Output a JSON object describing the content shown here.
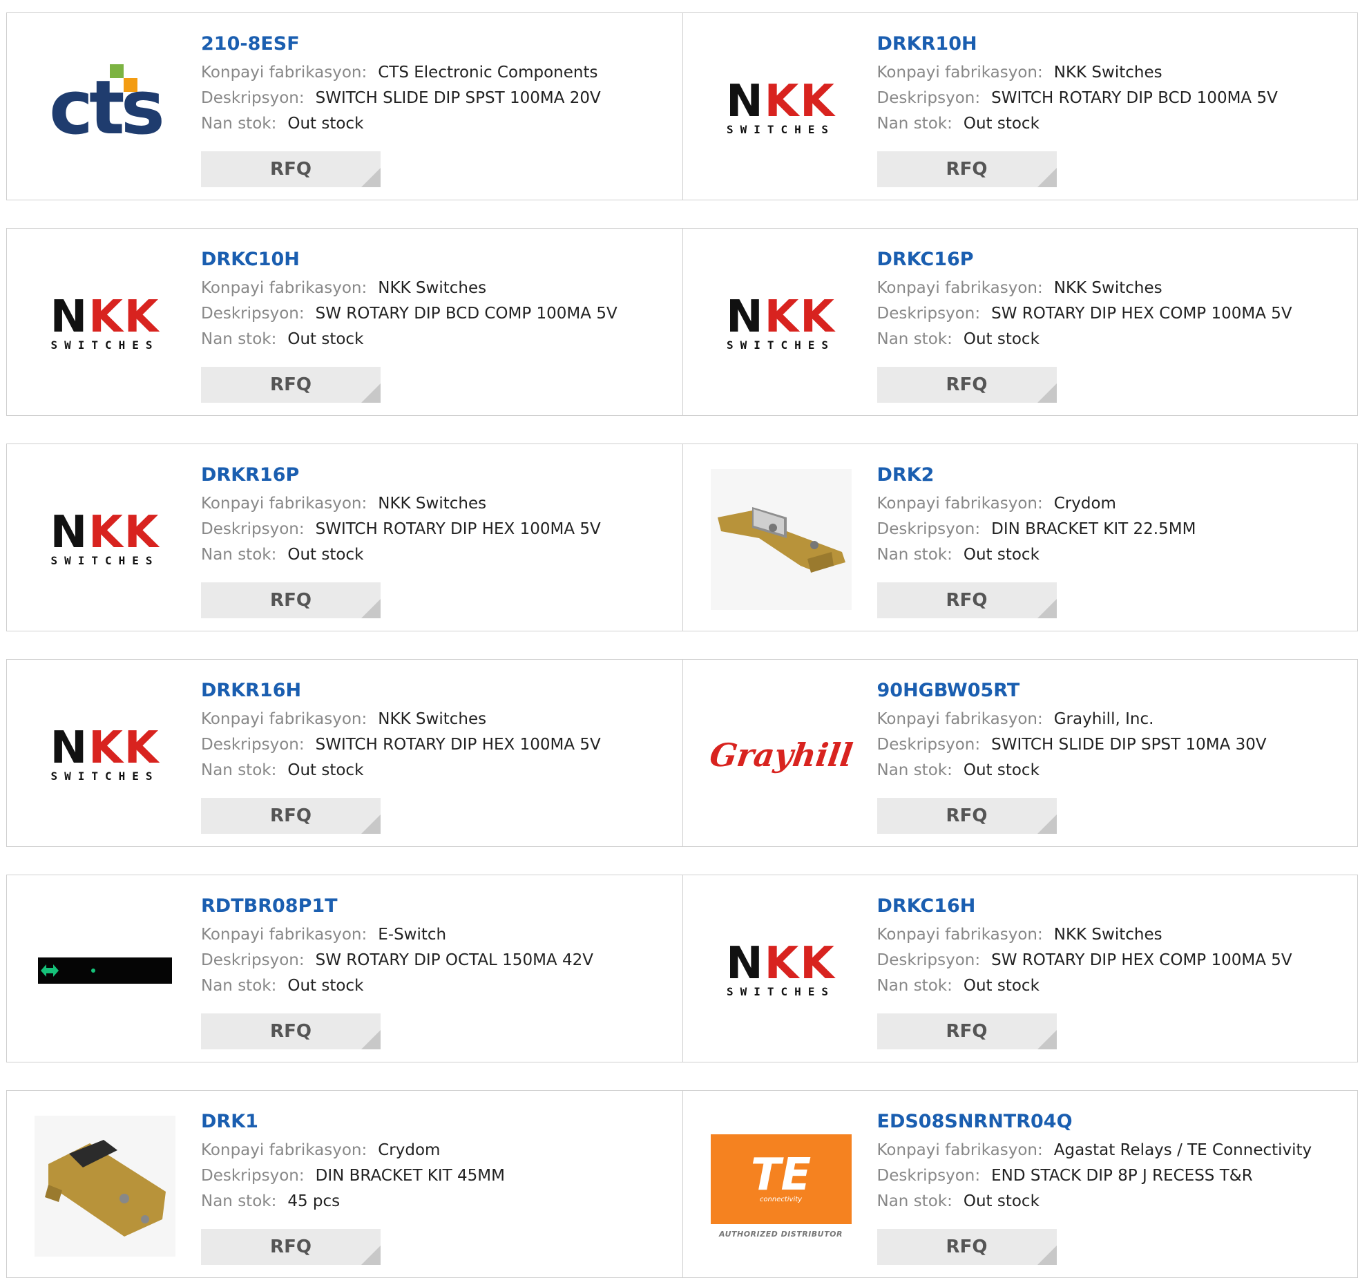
{
  "labels": {
    "manufacturer": "Konpayi fabrikasyon:",
    "description": "Deskripsyon:",
    "stock": "Nan stok:",
    "rfq": "RFQ"
  },
  "logo_text": {
    "cts": "cts",
    "nkk_top_black": "N",
    "nkk_top_red": "KK",
    "nkk_bottom": "SWITCHES",
    "grayhill": "Grayhill",
    "te": "TE",
    "te_sub": "connectivity",
    "te_dist": "AUTHORIZED DISTRIBUTOR"
  },
  "colors": {
    "part_link": "#1a5eb0",
    "label_gray": "#888888",
    "rfq_bg": "#eaeaea",
    "nkk_red": "#d8231f",
    "te_orange": "#f58220"
  },
  "products": [
    {
      "part": "210-8ESF",
      "manufacturer": "CTS Electronic Components",
      "description": "SWITCH SLIDE DIP SPST 100MA 20V",
      "stock": "Out stock",
      "logo": "cts-logo"
    },
    {
      "part": "DRKR10H",
      "manufacturer": "NKK Switches",
      "description": "SWITCH ROTARY DIP BCD 100MA 5V",
      "stock": "Out stock",
      "logo": "nkk-logo"
    },
    {
      "part": "DRKC10H",
      "manufacturer": "NKK Switches",
      "description": "SW ROTARY DIP BCD COMP 100MA 5V",
      "stock": "Out stock",
      "logo": "nkk-logo"
    },
    {
      "part": "DRKC16P",
      "manufacturer": "NKK Switches",
      "description": "SW ROTARY DIP HEX COMP 100MA 5V",
      "stock": "Out stock",
      "logo": "nkk-logo"
    },
    {
      "part": "DRKR16P",
      "manufacturer": "NKK Switches",
      "description": "SWITCH ROTARY DIP HEX 100MA 5V",
      "stock": "Out stock",
      "logo": "nkk-logo"
    },
    {
      "part": "DRK2",
      "manufacturer": "Crydom",
      "description": "DIN BRACKET KIT 22.5MM",
      "stock": "Out stock",
      "logo": "din-bracket-image"
    },
    {
      "part": "DRKR16H",
      "manufacturer": "NKK Switches",
      "description": "SWITCH ROTARY DIP HEX 100MA 5V",
      "stock": "Out stock",
      "logo": "nkk-logo"
    },
    {
      "part": "90HGBW05RT",
      "manufacturer": "Grayhill, Inc.",
      "description": "SWITCH SLIDE DIP SPST 10MA 30V",
      "stock": "Out stock",
      "logo": "grayhill-logo"
    },
    {
      "part": "RDTBR08P1T",
      "manufacturer": "E-Switch",
      "description": "SW ROTARY DIP OCTAL 150MA 42V",
      "stock": "Out stock",
      "logo": "eswitch-logo"
    },
    {
      "part": "DRKC16H",
      "manufacturer": "NKK Switches",
      "description": "SW ROTARY DIP HEX COMP 100MA 5V",
      "stock": "Out stock",
      "logo": "nkk-logo"
    },
    {
      "part": "DRK1",
      "manufacturer": "Crydom",
      "description": "DIN BRACKET KIT 45MM",
      "stock": "45 pcs",
      "logo": "din-bracket-image"
    },
    {
      "part": "EDS08SNRNTR04Q",
      "manufacturer": "Agastat Relays / TE Connectivity",
      "description": "END STACK DIP 8P J RECESS T&R",
      "stock": "Out stock",
      "logo": "te-logo"
    }
  ]
}
